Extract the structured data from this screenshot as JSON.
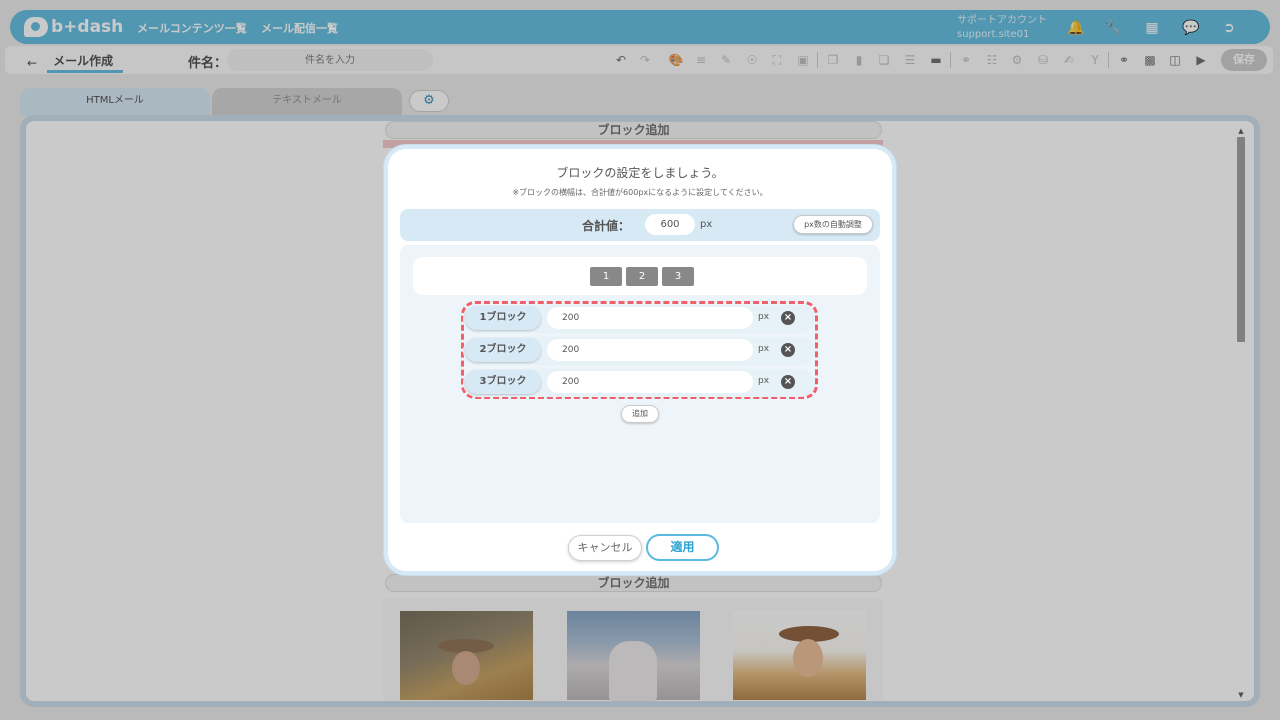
{
  "app": {
    "brand": "b+dash",
    "nav": [
      "メールコンテンツ一覧",
      "メール配信一覧"
    ],
    "account_name": "サポートアカウント",
    "account_site": "support.site01"
  },
  "toolbar": {
    "back_label": "メール作成",
    "subject_label": "件名：",
    "subject_placeholder": "件名を入力",
    "save_label": "保存"
  },
  "tabs": {
    "html": "HTMLメール",
    "text": "テキストメール"
  },
  "editor": {
    "add_block_top": "ブロック追加",
    "add_block_bottom": "ブロック追加"
  },
  "modal": {
    "title": "ブロックの設定をしましょう。",
    "note": "※ブロックの横幅は、合計値が600pxになるように設定してください。",
    "total_label": "合計値：",
    "total_value": "600",
    "total_unit": "px",
    "auto_adjust_label": "px数の自動調整",
    "counts": [
      "1",
      "2",
      "3"
    ],
    "rows": [
      {
        "label": "1ブロック",
        "value": "200",
        "unit": "px"
      },
      {
        "label": "2ブロック",
        "value": "200",
        "unit": "px"
      },
      {
        "label": "3ブロック",
        "value": "200",
        "unit": "px"
      }
    ],
    "add_label": "追加",
    "cancel_label": "キャンセル",
    "apply_label": "適用"
  },
  "colors": {
    "accent": "#5ab9df",
    "highlight": "#f0606a"
  }
}
